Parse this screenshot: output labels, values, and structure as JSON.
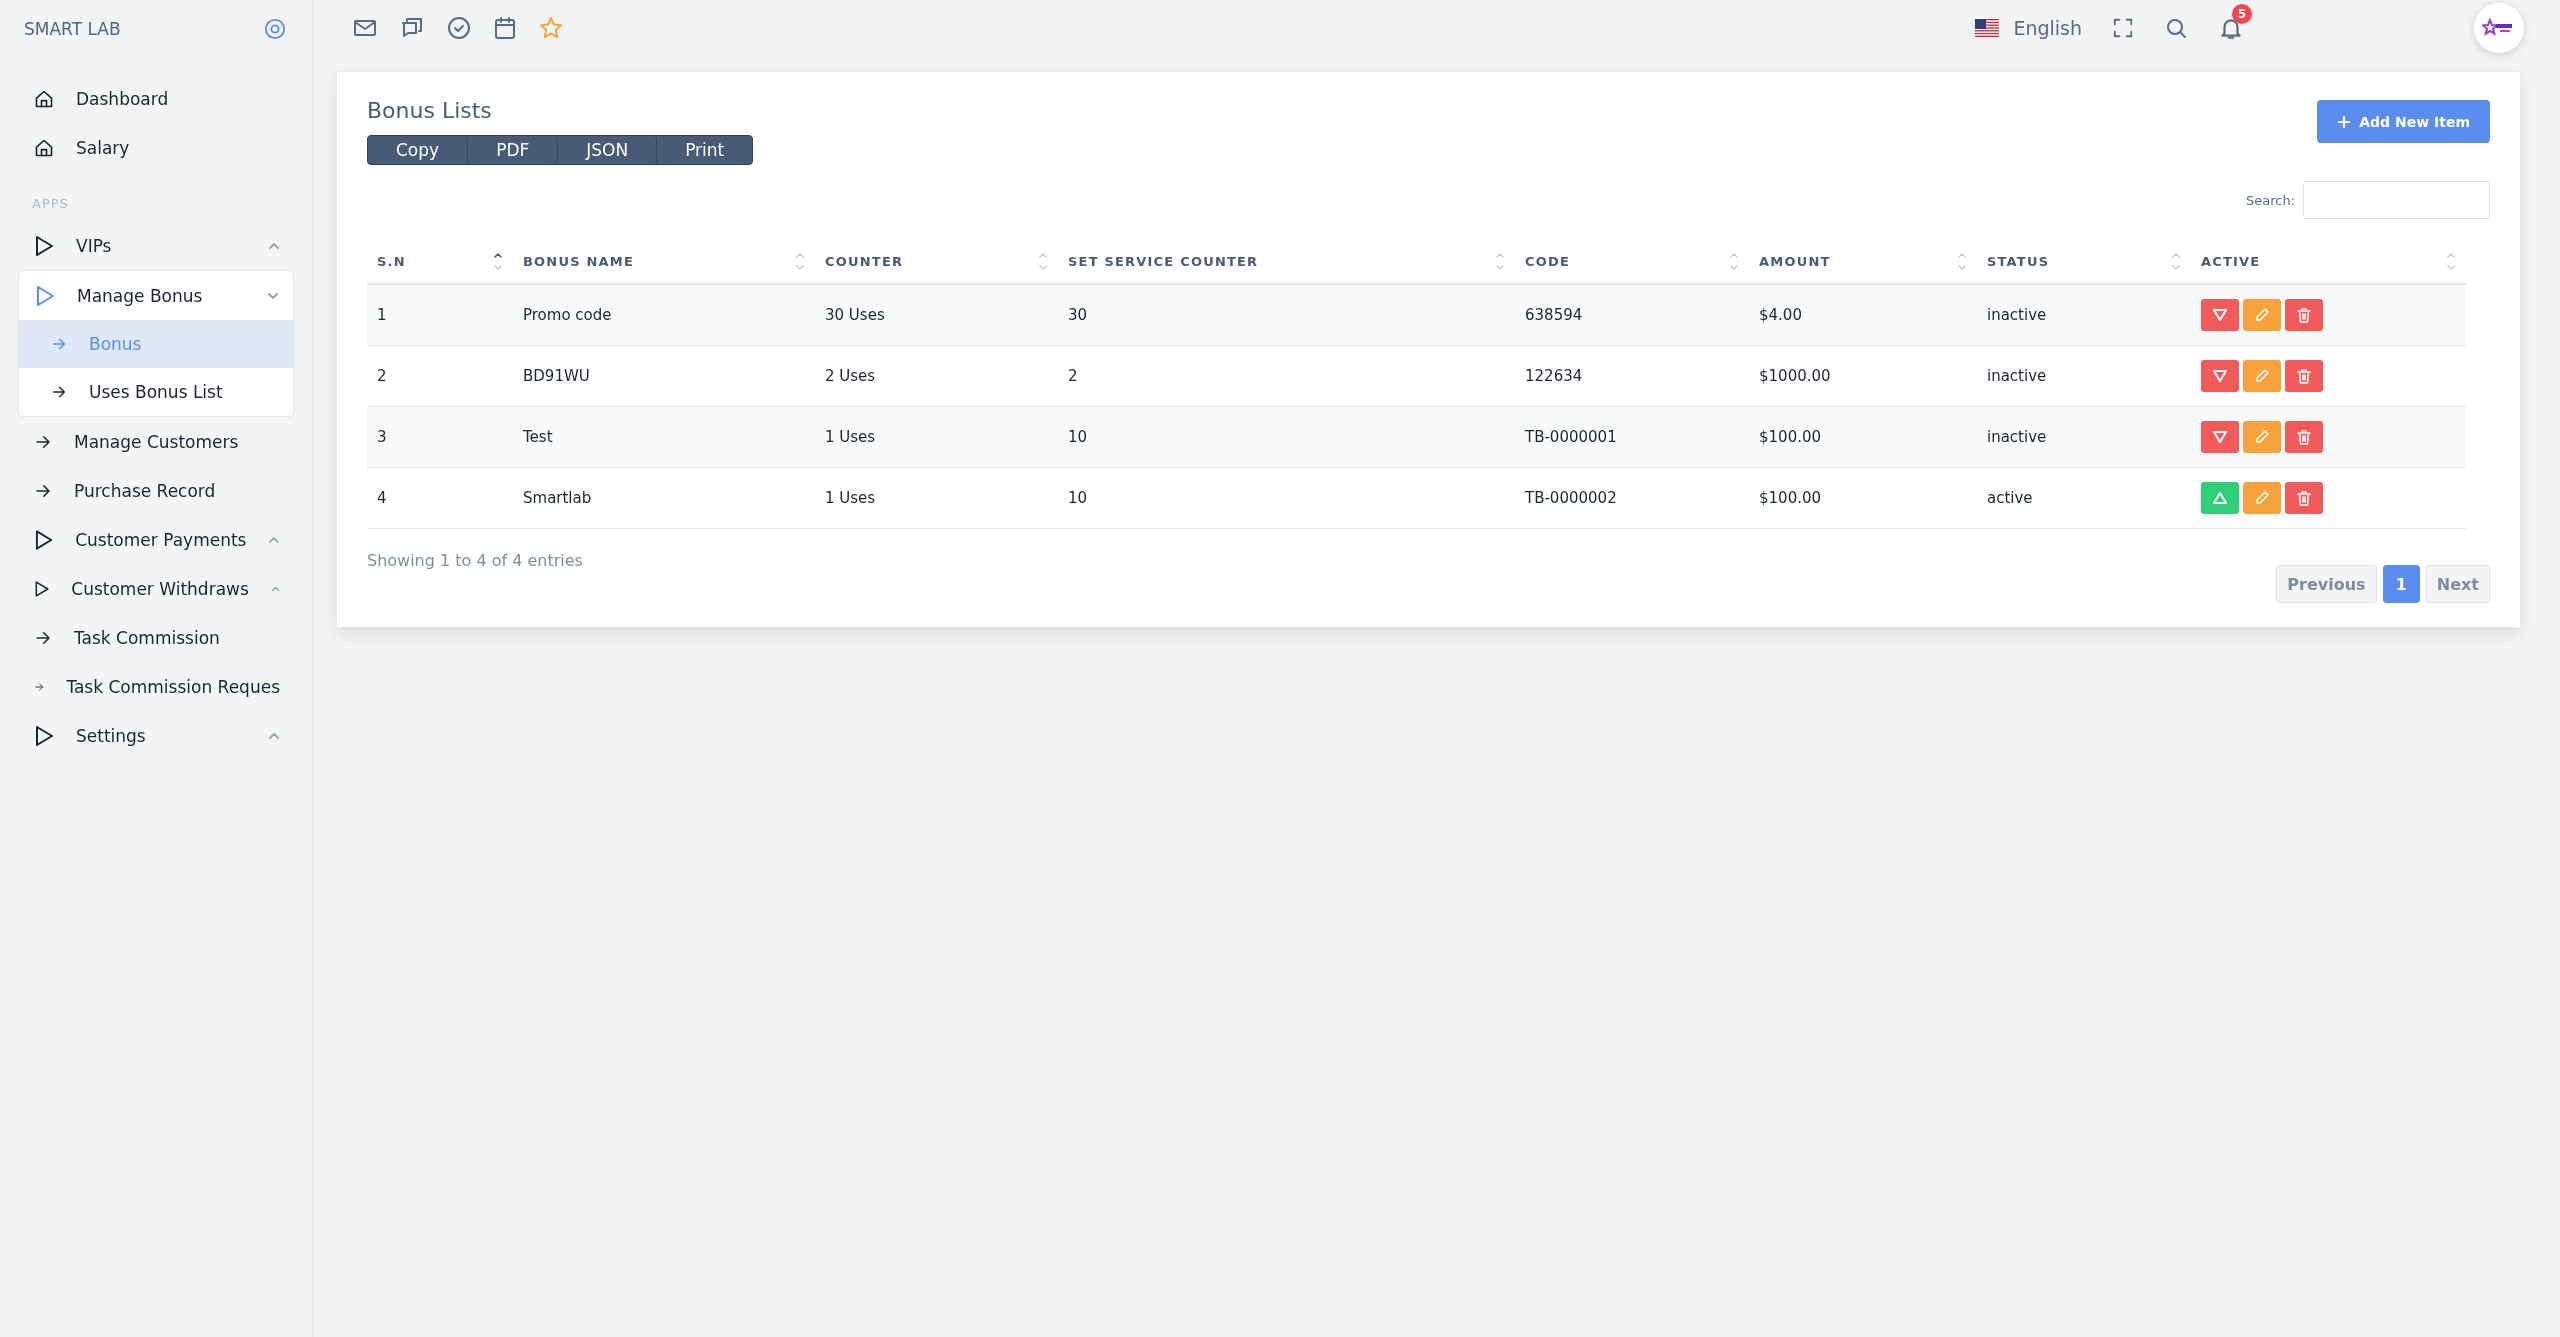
{
  "sidebar": {
    "brand": "SMART LAB",
    "section_label": "APPS",
    "items": [
      {
        "kind": "home",
        "label": "Dashboard"
      },
      {
        "kind": "home",
        "label": "Salary"
      },
      {
        "kind": "section"
      },
      {
        "kind": "triangle",
        "label": "VIPs",
        "expanded": false
      },
      {
        "kind": "triangle",
        "label": "Manage Bonus",
        "expanded": true,
        "children": [
          {
            "label": "Bonus",
            "selected": true
          },
          {
            "label": "Uses Bonus List",
            "selected": false
          }
        ]
      },
      {
        "kind": "arrow",
        "label": "Manage Customers"
      },
      {
        "kind": "arrow",
        "label": "Purchase Record"
      },
      {
        "kind": "triangle",
        "label": "Customer Payments",
        "expanded": false
      },
      {
        "kind": "triangle",
        "label": "Customer Withdraws",
        "expanded": false
      },
      {
        "kind": "arrow",
        "label": "Task Commission"
      },
      {
        "kind": "arrow",
        "label": "Task Commission Reques"
      },
      {
        "kind": "triangle",
        "label": "Settings",
        "expanded": false
      }
    ]
  },
  "topbar": {
    "language": "English",
    "notification_count": "5"
  },
  "card": {
    "title": "Bonus Lists",
    "export_buttons": [
      "Copy",
      "PDF",
      "JSON",
      "Print"
    ],
    "add_button": "Add New Item",
    "search_label": "Search:",
    "columns": [
      {
        "label": "S.N",
        "sorted": true
      },
      {
        "label": "BONUS NAME",
        "sorted": false
      },
      {
        "label": "COUNTER",
        "sorted": false
      },
      {
        "label": "SET SERVICE COUNTER",
        "sorted": false
      },
      {
        "label": "CODE",
        "sorted": false
      },
      {
        "label": "AMOUNT",
        "sorted": false
      },
      {
        "label": "STATUS",
        "sorted": false
      },
      {
        "label": "ACTIVE",
        "sorted": false
      }
    ],
    "rows": [
      {
        "sn": "1",
        "name": "Promo code",
        "counter": "30 Uses",
        "service_counter": "30",
        "code": "638594",
        "amount": "$4.00",
        "status": "inactive",
        "active": false
      },
      {
        "sn": "2",
        "name": "BD91WU",
        "counter": "2 Uses",
        "service_counter": "2",
        "code": "122634",
        "amount": "$1000.00",
        "status": "inactive",
        "active": false
      },
      {
        "sn": "3",
        "name": "Test",
        "counter": "1 Uses",
        "service_counter": "10",
        "code": "TB-0000001",
        "amount": "$100.00",
        "status": "inactive",
        "active": false
      },
      {
        "sn": "4",
        "name": "Smartlab",
        "counter": "1 Uses",
        "service_counter": "10",
        "code": "TB-0000002",
        "amount": "$100.00",
        "status": "active",
        "active": true
      }
    ],
    "info": "Showing 1 to 4 of 4 entries",
    "pagination": [
      {
        "label": "Previous",
        "kind": "nav",
        "selected": false
      },
      {
        "label": "1",
        "kind": "page",
        "selected": true
      },
      {
        "label": "Next",
        "kind": "nav",
        "selected": false
      }
    ]
  }
}
